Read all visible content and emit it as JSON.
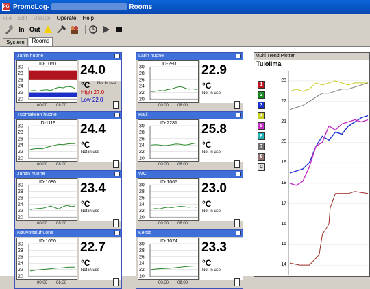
{
  "window": {
    "app_name": "PromoLog",
    "separator": " - ",
    "title_tail": "Rooms"
  },
  "menu": [
    {
      "label": "File",
      "enabled": false
    },
    {
      "label": "Edit",
      "enabled": false
    },
    {
      "label": "Design",
      "enabled": false
    },
    {
      "label": "Operate",
      "enabled": true
    },
    {
      "label": "Help",
      "enabled": true
    }
  ],
  "toolbar": {
    "in_label": "In",
    "out_label": "Out"
  },
  "tabs": [
    {
      "label": "System",
      "active": false
    },
    {
      "label": "Rooms",
      "active": true
    }
  ],
  "rooms": [
    {
      "name": "Janin huone",
      "id": "ID-1060",
      "value": "24.0",
      "unit": "°C",
      "status": "Not in use",
      "high": "High 27.0",
      "low": "Low 22.0",
      "alarm": true,
      "series": [
        22.5,
        22.6,
        22.4,
        22.7,
        22.8,
        22.6,
        23.2,
        23.6,
        23.4,
        23.8,
        23.7,
        23.2
      ]
    },
    {
      "name": "Larin huone",
      "id": "ID-290",
      "value": "22.9",
      "unit": "°C",
      "status": "Not in use",
      "alarm": false,
      "series": [
        22.3,
        22.4,
        22.6,
        22.5,
        22.9,
        23.1,
        23.5,
        23.8,
        23.4,
        23.0,
        23.1,
        22.9
      ]
    },
    {
      "name": "Tuomaksen huone",
      "id": "ID-1119",
      "value": "24.4",
      "unit": "°C",
      "status": "Not in use",
      "alarm": false,
      "series": [
        22.6,
        22.8,
        22.9,
        22.8,
        23.3,
        23.6,
        23.9,
        24.2,
        24.1,
        24.3,
        24.4,
        24.4
      ]
    },
    {
      "name": "Halli",
      "id": "ID-2281",
      "value": "25.8",
      "unit": "°C",
      "status": "Not in use",
      "alarm": false,
      "series": [
        24.0,
        24.1,
        24.0,
        23.8,
        23.9,
        24.1,
        24.3,
        24.2,
        24.0,
        24.1,
        24.4,
        24.6
      ]
    },
    {
      "name": "Juhan huone",
      "id": "ID-1086",
      "value": "23.4",
      "unit": "°C",
      "status": "Not in use",
      "alarm": false,
      "series": [
        22.3,
        22.5,
        22.6,
        22.7,
        23.0,
        23.4,
        22.9,
        22.5,
        23.2,
        23.6,
        23.2,
        23.4
      ]
    },
    {
      "name": "WC",
      "id": "ID-1066",
      "value": "23.0",
      "unit": "°C",
      "status": "Not in use",
      "alarm": false,
      "series": [
        22.4,
        22.6,
        22.5,
        22.8,
        23.0,
        22.9,
        23.1,
        23.3,
        23.2,
        23.0,
        23.1,
        23.0
      ]
    },
    {
      "name": "Neuvotteluhuone",
      "id": "ID-1050",
      "value": "22.7",
      "unit": "°C",
      "status": "Not in use",
      "alarm": false,
      "series": [
        21.5,
        21.8,
        22.0,
        22.2,
        22.4,
        22.5,
        22.7,
        22.7
      ]
    },
    {
      "name": "Keittiö",
      "id": "ID-1074",
      "value": "23.3",
      "unit": "°C",
      "status": "Not in use",
      "alarm": false,
      "series": [
        22.0,
        22.2,
        22.3,
        22.4,
        22.6,
        22.8,
        23.0,
        23.1
      ]
    }
  ],
  "chart_axis": {
    "y_ticks": [
      "30",
      "28",
      "26",
      "24",
      "22",
      "20"
    ],
    "x_ticks": [
      "00:00",
      "08:00"
    ]
  },
  "trend": {
    "window_title": "Multi Trend Plotter",
    "name": "Tuloilma",
    "legend": [
      {
        "label": "1",
        "color": "#c0141e"
      },
      {
        "label": "2",
        "color": "#168a1f"
      },
      {
        "label": "3",
        "color": "#1a2fd0"
      },
      {
        "label": "4",
        "color": "#c8cc20"
      },
      {
        "label": "5",
        "color": "#c430c4"
      },
      {
        "label": "6",
        "color": "#20b0b8"
      },
      {
        "label": "7",
        "color": "#6e6e6e"
      },
      {
        "label": "8",
        "color": "#907070"
      },
      {
        "label": "C",
        "color": "#e0e0e0"
      }
    ],
    "y_ticks": [
      "23",
      "22",
      "21",
      "20",
      "19",
      "18",
      "17",
      "16",
      "15",
      "14"
    ]
  },
  "chart_data": {
    "type": "line",
    "title": "Tuloilma",
    "ylim": [
      13.5,
      23.5
    ],
    "series": [
      {
        "x": [
          0,
          10,
          20,
          30,
          40,
          50,
          60,
          70,
          80,
          90,
          100,
          110,
          120
        ],
        "values": [
          22.5,
          22.6,
          22.5,
          22.6,
          22.9,
          22.8,
          22.9,
          23.0,
          22.9,
          22.8,
          22.9,
          22.9,
          22.9
        ]
      },
      {
        "x": [
          0,
          10,
          20,
          30,
          40,
          50,
          60,
          70,
          80,
          90,
          100,
          110,
          120
        ],
        "values": [
          21.6,
          21.7,
          21.8,
          22.0,
          22.2,
          22.4,
          22.4,
          22.5,
          22.6,
          22.6,
          22.7,
          22.8,
          22.9
        ]
      },
      {
        "x": [
          0,
          10,
          20,
          30,
          40,
          50,
          60,
          70,
          80,
          90,
          100,
          110,
          120
        ],
        "values": [
          18.5,
          18.6,
          18.7,
          19.0,
          19.8,
          20.3,
          20.1,
          20.5,
          20.4,
          20.8,
          21.0,
          21.2,
          21.3
        ]
      },
      {
        "x": [
          0,
          10,
          20,
          30,
          40,
          50,
          60,
          70,
          80,
          90,
          100,
          110,
          120
        ],
        "values": [
          18.0,
          17.9,
          18.1,
          18.8,
          19.8,
          20.0,
          20.8,
          20.6,
          20.9,
          21.0,
          21.1,
          21.0,
          21.1
        ]
      },
      {
        "x": [
          0,
          15,
          30,
          45,
          50,
          60,
          62,
          70,
          75,
          90,
          100,
          120
        ],
        "values": [
          14.1,
          14.0,
          14.0,
          14.5,
          15.5,
          16.0,
          16.8,
          17.5,
          17.5,
          17.5,
          17.6,
          17.5
        ]
      }
    ]
  }
}
